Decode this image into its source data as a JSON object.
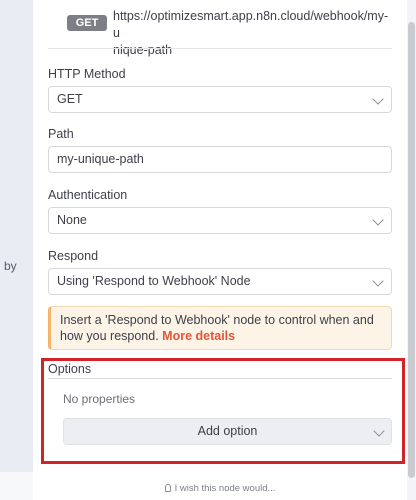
{
  "sidebar": {
    "by_text": "by"
  },
  "webhook": {
    "method_badge": "GET",
    "url_line1": "https://optimizesmart.app.n8n.cloud/webhook/my-u",
    "url_line2": "nique-path"
  },
  "fields": {
    "http_method": {
      "label": "HTTP Method",
      "value": "GET"
    },
    "path": {
      "label": "Path",
      "value": "my-unique-path"
    },
    "authentication": {
      "label": "Authentication",
      "value": "None"
    },
    "respond": {
      "label": "Respond",
      "value": "Using 'Respond to Webhook' Node"
    }
  },
  "notice": {
    "text": "Insert a 'Respond to Webhook' node to control when and how you respond. ",
    "link": "More details"
  },
  "options": {
    "title": "Options",
    "empty_text": "No properties",
    "add_button": "Add option"
  },
  "footer": {
    "wish_text": "I wish this node would..."
  },
  "colors": {
    "highlight_box": "#d2232a",
    "notice_bg": "#fdf3e6",
    "link": "#e0573b",
    "badge": "#7e7f86"
  }
}
